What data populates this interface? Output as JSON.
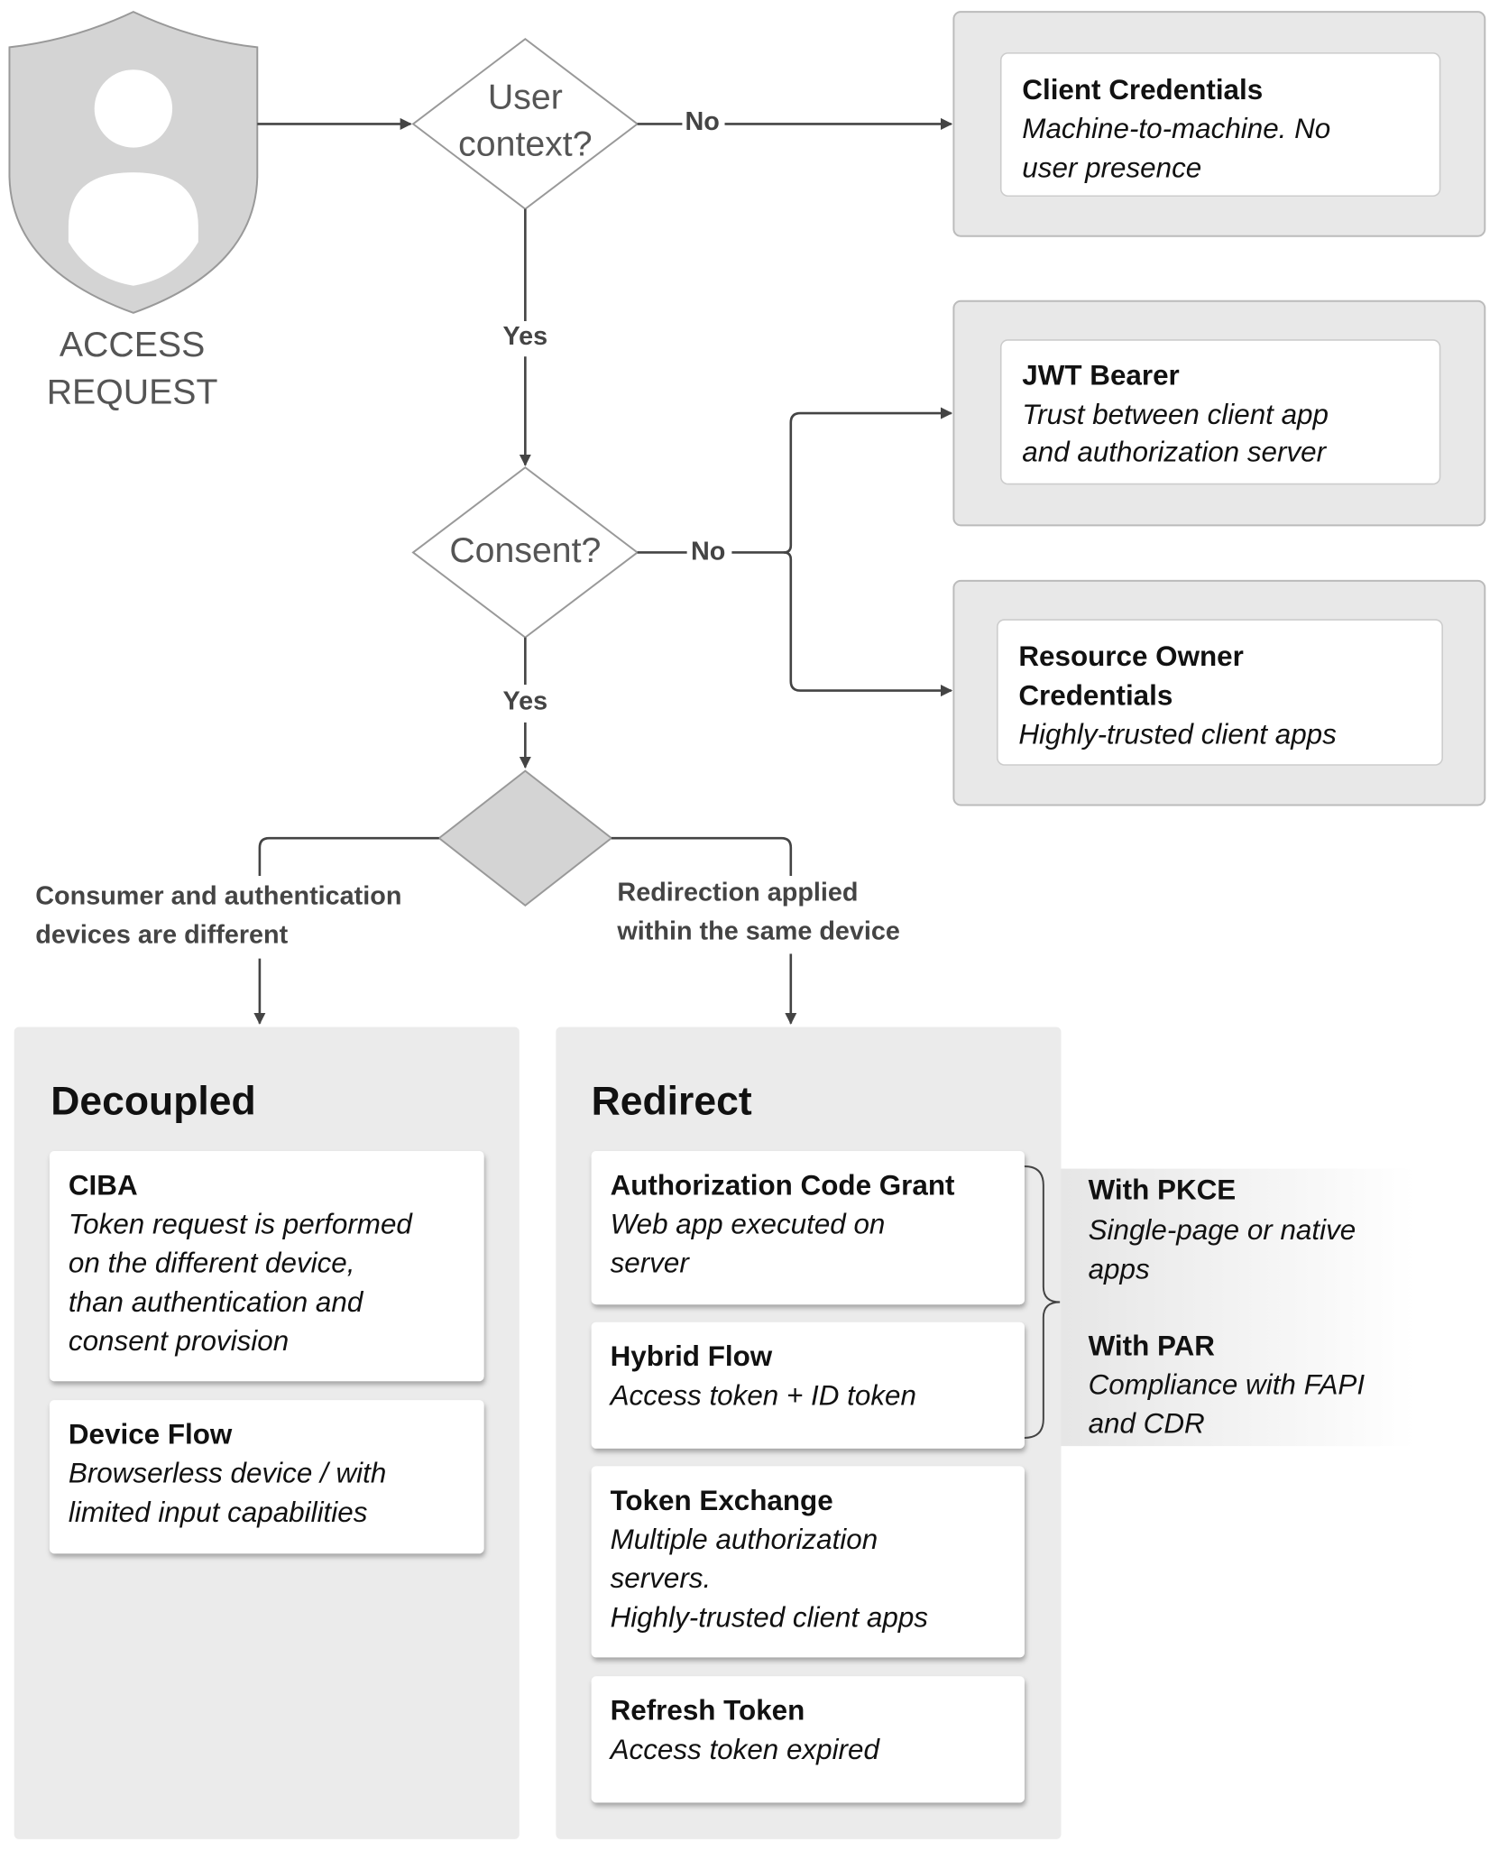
{
  "start": {
    "line1": "ACCESS",
    "line2": "REQUEST",
    "icon": "shield-user-icon"
  },
  "decision_user": {
    "line1": "User",
    "line2": "context?",
    "no": "No",
    "yes": "Yes"
  },
  "decision_consent": {
    "label": "Consent?",
    "no": "No",
    "yes": "Yes"
  },
  "branch": {
    "left": [
      "Consumer and authentication",
      "devices are different"
    ],
    "right": [
      "Redirection applied",
      "within the same device"
    ]
  },
  "client_credentials": {
    "title": "Client Credentials",
    "desc": [
      "Machine-to-machine. No",
      "user presence"
    ]
  },
  "jwt_bearer": {
    "title": "JWT Bearer",
    "desc": [
      "Trust between client app",
      "and authorization server"
    ]
  },
  "resource_owner": {
    "title": [
      "Resource Owner",
      "Credentials"
    ],
    "desc": [
      "Highly-trusted client apps"
    ]
  },
  "decoupled": {
    "title": "Decoupled",
    "cards": [
      {
        "title": "CIBA",
        "desc": [
          "Token request is performed",
          "on the different device,",
          "than authentication and",
          "consent provision"
        ]
      },
      {
        "title": "Device Flow",
        "desc": [
          "Browserless device / with",
          "limited input capabilities"
        ]
      }
    ]
  },
  "redirect": {
    "title": "Redirect",
    "cards": [
      {
        "title": "Authorization Code Grant",
        "desc": [
          "Web app executed on",
          "server"
        ]
      },
      {
        "title": "Hybrid Flow",
        "desc": [
          "Access token + ID token"
        ]
      },
      {
        "title": "Token Exchange",
        "desc": [
          "Multiple authorization",
          "servers.",
          "Highly-trusted client apps"
        ]
      },
      {
        "title": "Refresh Token",
        "desc": [
          "Access token expired"
        ]
      }
    ],
    "extensions": [
      {
        "title": "With PKCE",
        "desc": [
          "Single-page or native",
          "apps"
        ]
      },
      {
        "title": "With PAR",
        "desc": [
          "Compliance with FAPI",
          "and CDR"
        ]
      }
    ]
  },
  "colors": {
    "group_fill": "#e8e8e8",
    "panel_fill": "#ebebeb",
    "shield_fill": "#d4d4d4",
    "line": "#444444"
  }
}
